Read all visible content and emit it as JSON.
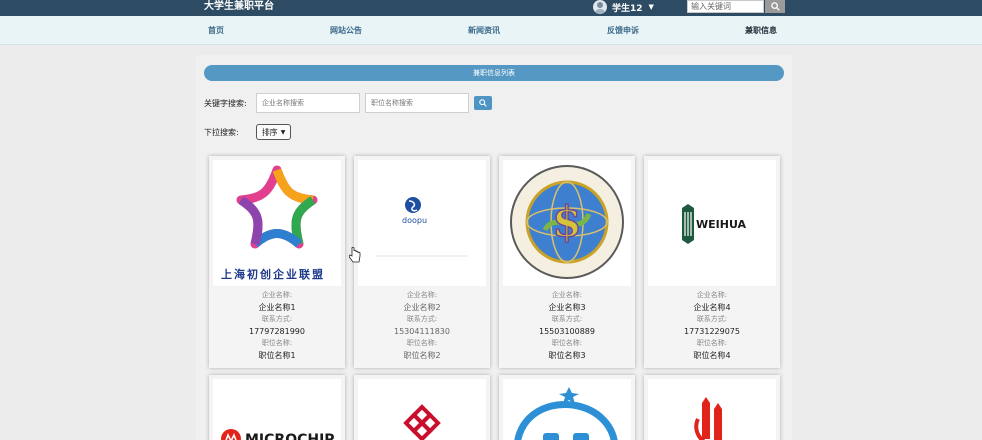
{
  "header": {
    "brand": "大学生兼职平台",
    "username": "学生12",
    "search_placeholder": "输入关键词"
  },
  "nav": {
    "items": [
      {
        "label": "首页"
      },
      {
        "label": "网站公告"
      },
      {
        "label": "新闻资讯"
      },
      {
        "label": "反馈申诉"
      },
      {
        "label": "兼职信息"
      }
    ],
    "active": "兼职信息"
  },
  "list": {
    "title": "兼职信息列表",
    "keyword_label": "关键字搜索:",
    "company_placeholder": "企业名称搜索",
    "position_placeholder": "职位名称搜索",
    "dropdown_label": "下拉搜索:",
    "sort_label": "排序"
  },
  "cards": [
    {
      "company_key": "企业名称:",
      "company": "企业名称1",
      "contact_key": "联系方式:",
      "contact": "17797281990",
      "position_key": "职位名称:",
      "position": "职位名称1",
      "logo": "shanghai-chuchuang-logo",
      "logo_text": "上海初创企业联盟"
    },
    {
      "company_key": "企业名称:",
      "company": "企业名称2",
      "contact_key": "联系方式:",
      "contact": "15304111830",
      "position_key": "职位名称:",
      "position": "职位名称2",
      "logo": "doopu-logo",
      "logo_text": "doopu"
    },
    {
      "company_key": "企业名称:",
      "company": "企业名称3",
      "contact_key": "联系方式:",
      "contact": "15503100889",
      "position_key": "职位名称:",
      "position": "职位名称3",
      "logo": "zhejiang-investment-seal-logo",
      "logo_text": "XIANGYANG ZHEJIANG INVESTMENT CO.,LTD"
    },
    {
      "company_key": "企业名称:",
      "company": "企业名称4",
      "contact_key": "联系方式:",
      "contact": "17731229075",
      "position_key": "职位名称:",
      "position": "职位名称4",
      "logo": "weihua-logo",
      "logo_text": "WEIHUA"
    }
  ],
  "cards_row2": [
    {
      "logo": "microchip-logo",
      "logo_text": "MICROCHIP"
    },
    {
      "logo": "red-knot-logo"
    },
    {
      "logo": "blue-swoosh-logo"
    },
    {
      "logo": "red-crane-logo"
    }
  ],
  "colors": {
    "topbar": "#2d4b63",
    "nav_bg": "#e8f4f6",
    "accent": "#5598c3",
    "nav_text": "#3d6a8a"
  }
}
